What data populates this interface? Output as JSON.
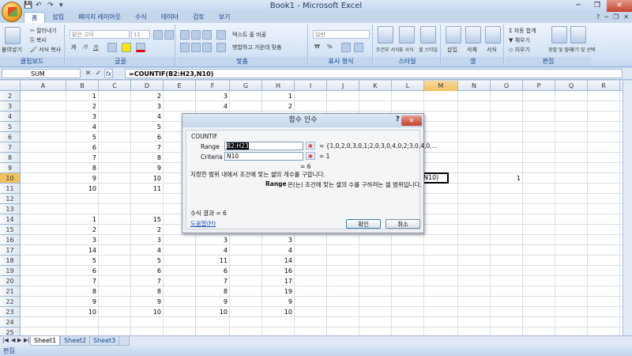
{
  "window": {
    "title": "Book1 - Microsoft Excel",
    "minimize": "─",
    "restore": "❐",
    "close": "✕"
  },
  "qat": [
    "💾",
    "↶",
    "↷",
    "▾"
  ],
  "ribbon_tabs": [
    "홈",
    "삽입",
    "페이지 레이아웃",
    "수식",
    "데이터",
    "검토",
    "보기"
  ],
  "active_tab": "홈",
  "tabs_right": [
    "?",
    "─",
    "❐",
    "✕"
  ],
  "ribbon": {
    "clipboard": {
      "label": "클립보드",
      "paste": "붙여넣기",
      "cut": "잘라내기",
      "copy": "복사",
      "format_painter": "서식 복사"
    },
    "font": {
      "label": "글꼴",
      "font_name": "맑은 고딕",
      "font_size": "11",
      "bold": "가",
      "italic": "가",
      "underline": "가"
    },
    "alignment": {
      "label": "맞춤",
      "wrap": "텍스트 줄 바꿈",
      "merge": "병합하고 가운데 맞춤"
    },
    "number": {
      "label": "표시 형식",
      "format": "일반",
      "currency": "₩",
      "percent": "%"
    },
    "styles": {
      "label": "스타일",
      "conditional": "조건부 서식",
      "table": "표 서식",
      "cell": "셀 스타일"
    },
    "cells": {
      "label": "셀",
      "insert": "삽입",
      "delete": "삭제",
      "format": "서식"
    },
    "editing": {
      "label": "편집",
      "autosum": "자동 합계",
      "fill": "채우기",
      "clear": "지우기",
      "sort": "정렬 및 필터",
      "find": "찾기 및 선택"
    }
  },
  "formula_bar": {
    "name_box": "SUM",
    "cancel": "✕",
    "enter": "✓",
    "fx": "fx",
    "formula": "=COUNTIF(B2:H23,N10)"
  },
  "columns": [
    "A",
    "B",
    "C",
    "D",
    "E",
    "F",
    "G",
    "H",
    "I",
    "J",
    "K",
    "L",
    "M",
    "N",
    "O",
    "P",
    "Q",
    "R"
  ],
  "rows": [
    "2",
    "3",
    "4",
    "5",
    "6",
    "7",
    "8",
    "9",
    "10",
    "11",
    "12",
    "13",
    "14",
    "15",
    "16",
    "17",
    "18",
    "19",
    "20",
    "21",
    "22",
    "23",
    "24",
    "25"
  ],
  "cells": [
    {
      "row": "2",
      "col": "B",
      "v": "1"
    },
    {
      "row": "2",
      "col": "D",
      "v": "2"
    },
    {
      "row": "2",
      "col": "F",
      "v": "3"
    },
    {
      "row": "2",
      "col": "H",
      "v": "1"
    },
    {
      "row": "3",
      "col": "B",
      "v": "2"
    },
    {
      "row": "3",
      "col": "D",
      "v": "3"
    },
    {
      "row": "3",
      "col": "F",
      "v": "4"
    },
    {
      "row": "3",
      "col": "H",
      "v": "2"
    },
    {
      "row": "4",
      "col": "B",
      "v": "3"
    },
    {
      "row": "4",
      "col": "D",
      "v": "4"
    },
    {
      "row": "5",
      "col": "B",
      "v": "4"
    },
    {
      "row": "5",
      "col": "D",
      "v": "5"
    },
    {
      "row": "6",
      "col": "B",
      "v": "5"
    },
    {
      "row": "6",
      "col": "D",
      "v": "6"
    },
    {
      "row": "7",
      "col": "B",
      "v": "6"
    },
    {
      "row": "7",
      "col": "D",
      "v": "7"
    },
    {
      "row": "8",
      "col": "B",
      "v": "7"
    },
    {
      "row": "8",
      "col": "D",
      "v": "8"
    },
    {
      "row": "9",
      "col": "B",
      "v": "8"
    },
    {
      "row": "9",
      "col": "D",
      "v": "9"
    },
    {
      "row": "10",
      "col": "B",
      "v": "9"
    },
    {
      "row": "10",
      "col": "D",
      "v": "10"
    },
    {
      "row": "10",
      "col": "O",
      "v": "1"
    },
    {
      "row": "11",
      "col": "B",
      "v": "10"
    },
    {
      "row": "11",
      "col": "D",
      "v": "11"
    },
    {
      "row": "14",
      "col": "B",
      "v": "1"
    },
    {
      "row": "14",
      "col": "D",
      "v": "15"
    },
    {
      "row": "15",
      "col": "B",
      "v": "2"
    },
    {
      "row": "15",
      "col": "D",
      "v": "2"
    },
    {
      "row": "16",
      "col": "B",
      "v": "3"
    },
    {
      "row": "16",
      "col": "D",
      "v": "3"
    },
    {
      "row": "16",
      "col": "F",
      "v": "3"
    },
    {
      "row": "16",
      "col": "H",
      "v": "3"
    },
    {
      "row": "17",
      "col": "B",
      "v": "14"
    },
    {
      "row": "17",
      "col": "D",
      "v": "4"
    },
    {
      "row": "17",
      "col": "F",
      "v": "4"
    },
    {
      "row": "17",
      "col": "H",
      "v": "4"
    },
    {
      "row": "18",
      "col": "B",
      "v": "5"
    },
    {
      "row": "18",
      "col": "D",
      "v": "5"
    },
    {
      "row": "18",
      "col": "F",
      "v": "11"
    },
    {
      "row": "18",
      "col": "H",
      "v": "14"
    },
    {
      "row": "19",
      "col": "B",
      "v": "6"
    },
    {
      "row": "19",
      "col": "D",
      "v": "6"
    },
    {
      "row": "19",
      "col": "F",
      "v": "6"
    },
    {
      "row": "19",
      "col": "H",
      "v": "16"
    },
    {
      "row": "20",
      "col": "B",
      "v": "7"
    },
    {
      "row": "20",
      "col": "D",
      "v": "7"
    },
    {
      "row": "20",
      "col": "F",
      "v": "7"
    },
    {
      "row": "20",
      "col": "H",
      "v": "17"
    },
    {
      "row": "21",
      "col": "B",
      "v": "8"
    },
    {
      "row": "21",
      "col": "D",
      "v": "8"
    },
    {
      "row": "21",
      "col": "F",
      "v": "8"
    },
    {
      "row": "21",
      "col": "H",
      "v": "19"
    },
    {
      "row": "22",
      "col": "B",
      "v": "9"
    },
    {
      "row": "22",
      "col": "D",
      "v": "9"
    },
    {
      "row": "22",
      "col": "F",
      "v": "9"
    },
    {
      "row": "22",
      "col": "H",
      "v": "9"
    },
    {
      "row": "23",
      "col": "B",
      "v": "10"
    },
    {
      "row": "23",
      "col": "D",
      "v": "10"
    },
    {
      "row": "23",
      "col": "F",
      "v": "10"
    },
    {
      "row": "23",
      "col": "H",
      "v": "10"
    }
  ],
  "active_cell_text": "N10)",
  "dialog": {
    "title": "함수 인수",
    "help_q": "?",
    "close": "✕",
    "function_name": "COUNTIF",
    "range_label": "Range",
    "range_value": "B2:H23",
    "range_result": "= {1,0,2,0,3,0,1;2,0,3,0,4,0,2;3,0,4,0,...",
    "criteria_label": "Criteria",
    "criteria_value": "N10",
    "criteria_result": "= 1",
    "total_result": "= 6",
    "description": "지정한 범위 내에서 조건에 맞는 셀의 개수를 구합니다.",
    "arg_help_label": "Range",
    "arg_help": "은(는) 조건에 맞는 셀의 수를 구하려는 셀 범위입니다.",
    "formula_result": "수식 결과 =  6",
    "help_link": "도움말(H)",
    "ok": "확인",
    "cancel": "취소"
  },
  "sheets": [
    "Sheet1",
    "Sheet2",
    "Sheet3"
  ],
  "sheet_nav": [
    "|◀",
    "◀",
    "▶",
    "▶|"
  ],
  "status": "편집"
}
